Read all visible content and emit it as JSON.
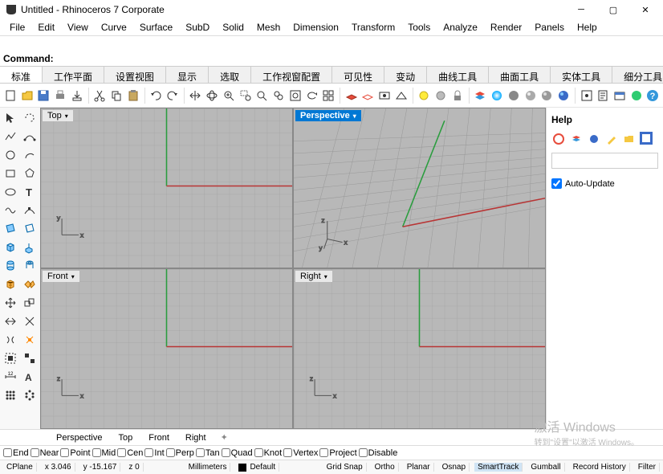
{
  "title": "Untitled - Rhinoceros 7 Corporate",
  "menu": [
    "File",
    "Edit",
    "View",
    "Curve",
    "Surface",
    "SubD",
    "Solid",
    "Mesh",
    "Dimension",
    "Transform",
    "Tools",
    "Analyze",
    "Render",
    "Panels",
    "Help"
  ],
  "cmd_label": "Command:",
  "tabs": [
    "标准",
    "工作平面",
    "设置视图",
    "显示",
    "选取",
    "工作视窗配置",
    "可见性",
    "变动",
    "曲线工具",
    "曲面工具",
    "实体工具",
    "细分工具"
  ],
  "active_tab": 0,
  "viewports": {
    "tl": "Top",
    "tr": "Perspective",
    "bl": "Front",
    "br": "Right",
    "active": "tr"
  },
  "help": {
    "title": "Help",
    "auto_update": "Auto-Update",
    "search_placeholder": ""
  },
  "vp_tabs": [
    "Perspective",
    "Top",
    "Front",
    "Right"
  ],
  "osnap": [
    "End",
    "Near",
    "Point",
    "Mid",
    "Cen",
    "Int",
    "Perp",
    "Tan",
    "Quad",
    "Knot",
    "Vertex",
    "Project",
    "Disable"
  ],
  "status": {
    "cplane": "CPlane",
    "x": "x 3.046",
    "y": "y -15.167",
    "z": "z 0",
    "units": "Millimeters",
    "layer_swatch": "#000",
    "layer": "Default",
    "items": [
      "Grid Snap",
      "Ortho",
      "Planar",
      "Osnap",
      "SmartTrack",
      "Gumball",
      "Record History",
      "Filter"
    ]
  },
  "watermark": {
    "main": "激活 Windows",
    "sub": "转到\"设置\"以激活 Windows。"
  }
}
